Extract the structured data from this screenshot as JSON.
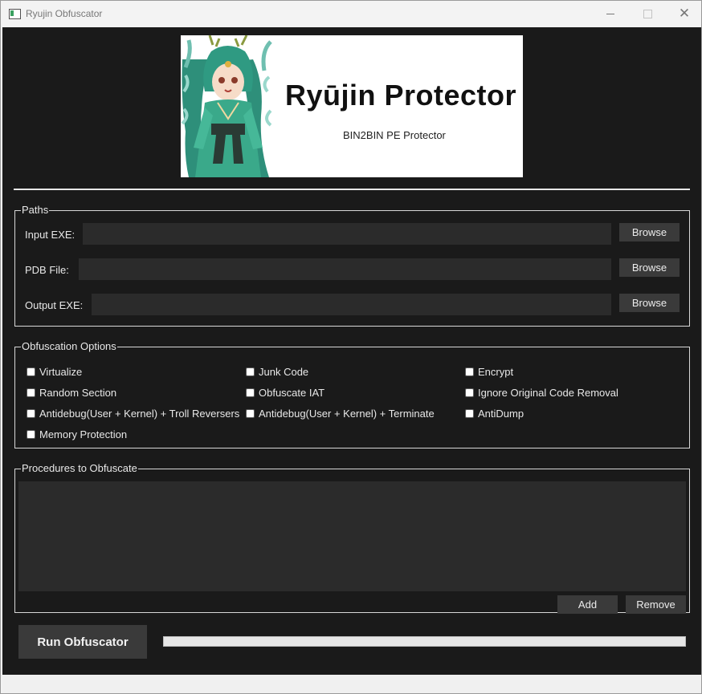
{
  "window": {
    "title": "Ryujin Obfuscator",
    "icon": "app-window-icon"
  },
  "banner": {
    "title": "Ryūjin Protector",
    "subtitle": "BIN2BIN PE Protector"
  },
  "paths": {
    "legend": "Paths",
    "input_label": "Input EXE:",
    "input_value": "",
    "pdb_label": "PDB File:",
    "pdb_value": "",
    "output_label": "Output EXE:",
    "output_value": "",
    "browse_label": "Browse"
  },
  "options": {
    "legend": "Obfuscation Options",
    "items": [
      {
        "label": "Virtualize",
        "checked": false
      },
      {
        "label": "Junk Code",
        "checked": false
      },
      {
        "label": "Encrypt",
        "checked": false
      },
      {
        "label": "Random Section",
        "checked": false
      },
      {
        "label": "Obfuscate IAT",
        "checked": false
      },
      {
        "label": "Ignore Original Code Removal",
        "checked": false
      },
      {
        "label": "Antidebug(User + Kernel) + Troll Reversers",
        "checked": false
      },
      {
        "label": "Antidebug(User + Kernel) + Terminate",
        "checked": false
      },
      {
        "label": "AntiDump",
        "checked": false
      },
      {
        "label": "Memory Protection",
        "checked": false
      }
    ]
  },
  "procedures": {
    "legend": "Procedures to Obfuscate",
    "add_label": "Add",
    "remove_label": "Remove"
  },
  "run": {
    "button_label": "Run Obfuscator",
    "progress": 0
  },
  "colors": {
    "background": "#1a1a1a",
    "field": "#2b2b2b",
    "button": "#3a3a3a",
    "text": "#e8e8e8"
  }
}
